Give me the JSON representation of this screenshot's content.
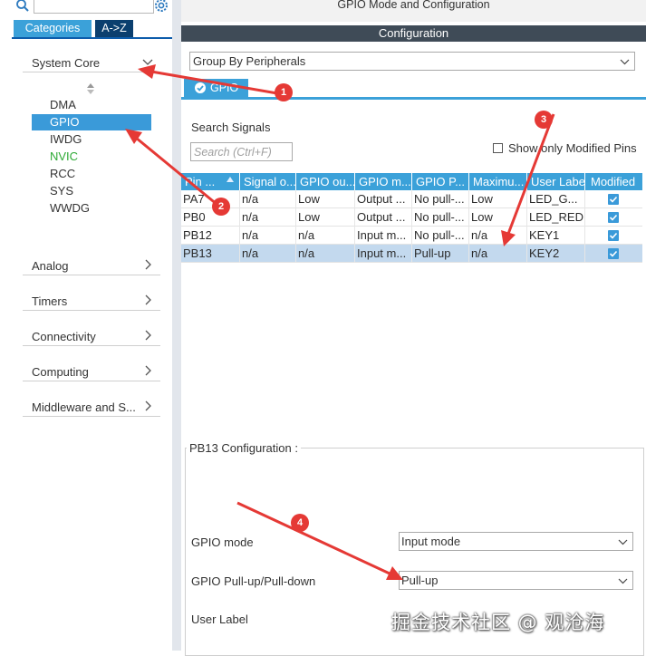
{
  "window_title": "GPIO Mode and Configuration",
  "left": {
    "tabs": [
      {
        "label": "Categories"
      },
      {
        "label": "A->Z"
      }
    ],
    "system_core": {
      "label": "System Core",
      "items": [
        {
          "label": "DMA"
        },
        {
          "label": "GPIO"
        },
        {
          "label": "IWDG"
        },
        {
          "label": "NVIC"
        },
        {
          "label": "RCC"
        },
        {
          "label": "SYS"
        },
        {
          "label": "WWDG"
        }
      ]
    },
    "categories": [
      {
        "label": "Analog"
      },
      {
        "label": "Timers"
      },
      {
        "label": "Connectivity"
      },
      {
        "label": "Computing"
      },
      {
        "label": "Middleware and S..."
      }
    ]
  },
  "right": {
    "config_bar": "Configuration",
    "group_select": "Group By Peripherals",
    "gpio_tab": "GPIO",
    "search_label": "Search Signals",
    "search_placeholder": "Search (Ctrl+F)",
    "show_modified": "Show only Modified Pins",
    "table": {
      "headers": [
        "Pin ...",
        "Signal o...",
        "GPIO ou...",
        "GPIO m...",
        "GPIO P...",
        "Maximu...",
        "User Label",
        "Modified"
      ],
      "rows": [
        {
          "pin": "PA7",
          "signal": "n/a",
          "output": "Low",
          "mode": "Output ...",
          "pull": "No pull-...",
          "max": "Low",
          "label": "LED_G...",
          "modified": true
        },
        {
          "pin": "PB0",
          "signal": "n/a",
          "output": "Low",
          "mode": "Output ...",
          "pull": "No pull-...",
          "max": "Low",
          "label": "LED_RED",
          "modified": true
        },
        {
          "pin": "PB12",
          "signal": "n/a",
          "output": "n/a",
          "mode": "Input m...",
          "pull": "No pull-...",
          "max": "n/a",
          "label": "KEY1",
          "modified": true
        },
        {
          "pin": "PB13",
          "signal": "n/a",
          "output": "n/a",
          "mode": "Input m...",
          "pull": "Pull-up",
          "max": "n/a",
          "label": "KEY2",
          "modified": true
        }
      ]
    },
    "pin_config": {
      "title": "PB13 Configuration :",
      "gpio_mode_label": "GPIO mode",
      "gpio_mode_value": "Input mode",
      "pull_label": "GPIO Pull-up/Pull-down",
      "pull_value": "Pull-up",
      "user_label": "User Label"
    }
  },
  "annotations": [
    {
      "label": "1"
    },
    {
      "label": "2"
    },
    {
      "label": "3"
    },
    {
      "label": "4"
    }
  ],
  "watermark": "掘金技术社区 @ 观沧海",
  "colors": {
    "accent": "#3ba1d9",
    "tab_dark": "#0b3f6f",
    "config_bar": "#3f4b57",
    "selected_row": "#c3d9ee",
    "nvic_green": "#2eaa36",
    "annotation_red": "#e53935"
  }
}
